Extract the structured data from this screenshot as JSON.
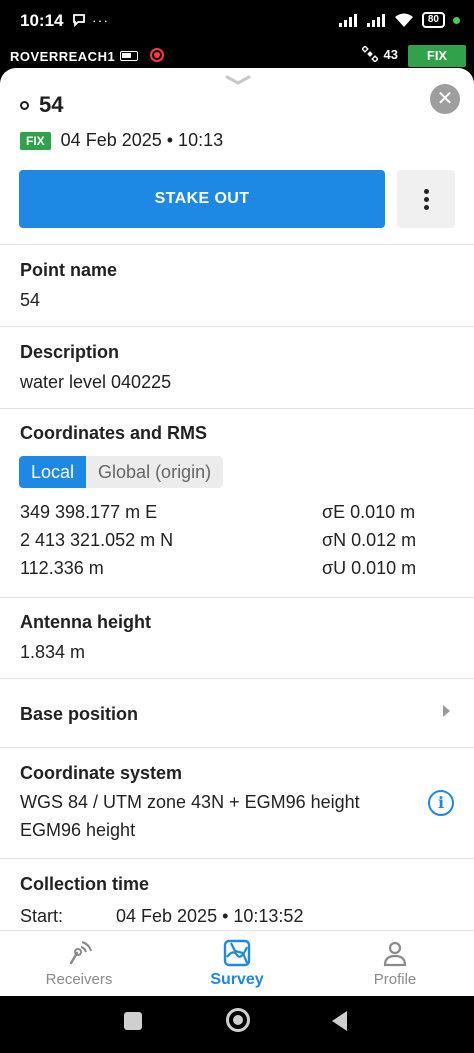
{
  "status_bar": {
    "time": "10:14",
    "battery": "80"
  },
  "app_bar": {
    "device_name": "ROVERREACH1",
    "satellite_count": "43",
    "fix_status": "FIX"
  },
  "point": {
    "title": "54",
    "fix_badge": "FIX",
    "fix_datetime": "04 Feb 2025 • 10:13"
  },
  "actions": {
    "stake_out_label": "STAKE OUT"
  },
  "point_name": {
    "label": "Point name",
    "value": "54"
  },
  "description": {
    "label": "Description",
    "value": "water level 040225"
  },
  "coordinates": {
    "label": "Coordinates and RMS",
    "tabs": [
      "Local",
      "Global (origin)"
    ],
    "selected_tab": "Local",
    "easting": "349 398.177 m E",
    "northing": "2 413 321.052 m N",
    "height": "112.336 m",
    "rms_e": "σE 0.010 m",
    "rms_n": "σN 0.012 m",
    "rms_u": "σU 0.010 m"
  },
  "antenna": {
    "label": "Antenna height",
    "value": "1.834 m"
  },
  "base_position": {
    "label": "Base position"
  },
  "coordinate_system": {
    "label": "Coordinate system",
    "line1": "WGS 84 / UTM zone 43N + EGM96 height",
    "line2": "EGM96 height"
  },
  "collection_time": {
    "label": "Collection time",
    "start_label": "Start:",
    "start_value": "04 Feb 2025 • 10:13:52"
  },
  "bottom_nav": {
    "items": [
      {
        "label": "Receivers",
        "icon": "receivers-icon"
      },
      {
        "label": "Survey",
        "icon": "survey-icon"
      },
      {
        "label": "Profile",
        "icon": "profile-icon"
      }
    ],
    "active": "Survey"
  },
  "colors": {
    "accent": "#1e88e5",
    "fix_green": "#30a24b",
    "record_red": "#ff3b3b"
  }
}
